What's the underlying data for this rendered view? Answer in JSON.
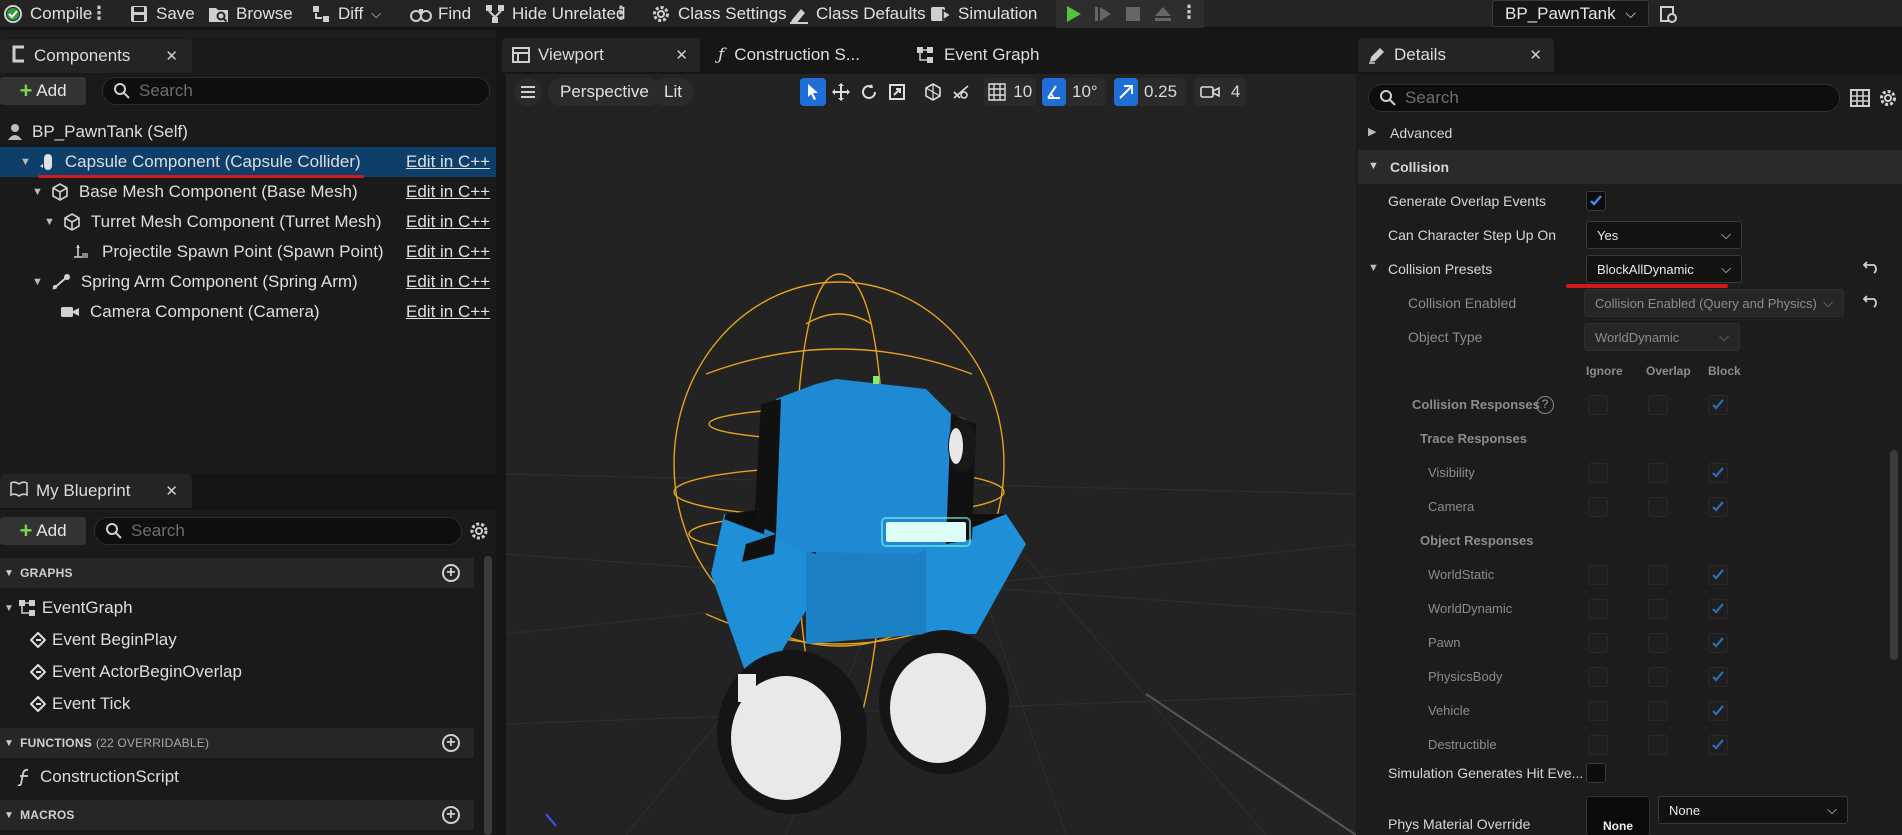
{
  "toolbar": {
    "compile": "Compile",
    "save": "Save",
    "browse": "Browse",
    "diff": "Diff",
    "find": "Find",
    "hide_unrelated": "Hide Unrelated",
    "class_settings": "Class Settings",
    "class_defaults": "Class Defaults",
    "simulation": "Simulation",
    "debug_object": "BP_PawnTank"
  },
  "components": {
    "tab_title": "Components",
    "add_label": "Add",
    "search_placeholder": "Search",
    "root": "BP_PawnTank (Self)",
    "items": [
      {
        "label": "Capsule Component (Capsule Collider)",
        "edit": "Edit in C++",
        "icon": "capsule-icon"
      },
      {
        "label": "Base Mesh Component (Base Mesh)",
        "edit": "Edit in C++",
        "icon": "static-mesh-icon"
      },
      {
        "label": "Turret Mesh Component (Turret Mesh)",
        "edit": "Edit in C++",
        "icon": "static-mesh-icon"
      },
      {
        "label": "Projectile Spawn Point (Spawn Point)",
        "edit": "Edit in C++",
        "icon": "scene-component-icon"
      },
      {
        "label": "Spring Arm Component (Spring Arm)",
        "edit": "Edit in C++",
        "icon": "spring-arm-icon"
      },
      {
        "label": "Camera Component (Camera)",
        "edit": "Edit in C++",
        "icon": "camera-icon"
      }
    ]
  },
  "my_blueprint": {
    "tab_title": "My Blueprint",
    "add_label": "Add",
    "search_placeholder": "Search",
    "graphs_header": "GRAPHS",
    "graph_name": "EventGraph",
    "events": [
      "Event BeginPlay",
      "Event ActorBeginOverlap",
      "Event Tick"
    ],
    "functions_header": "FUNCTIONS",
    "functions_sub": "(22 OVERRIDABLE)",
    "function_item": "ConstructionScript",
    "macros_header": "MACROS"
  },
  "editor_tabs": {
    "viewport": "Viewport",
    "construction": "Construction S...",
    "event_graph": "Event Graph"
  },
  "viewport": {
    "perspective": "Perspective",
    "lit": "Lit",
    "grid_snap": "10",
    "rotation_snap": "10°",
    "scale_snap": "0.25",
    "camera_speed": "4"
  },
  "details": {
    "tab_title": "Details",
    "search_placeholder": "Search",
    "advanced": "Advanced",
    "collision": "Collision",
    "generate_overlap": "Generate Overlap Events",
    "step_up": "Can Character Step Up On",
    "step_up_value": "Yes",
    "presets": "Collision Presets",
    "presets_value": "BlockAllDynamic",
    "collision_enabled": "Collision Enabled",
    "collision_enabled_value": "Collision Enabled (Query and Physics)",
    "object_type": "Object Type",
    "object_type_value": "WorldDynamic",
    "col_ignore": "Ignore",
    "col_overlap": "Overlap",
    "col_block": "Block",
    "collision_responses": "Collision Responses",
    "trace_responses": "Trace Responses",
    "trace_items": [
      "Visibility",
      "Camera"
    ],
    "object_responses": "Object Responses",
    "object_items": [
      "WorldStatic",
      "WorldDynamic",
      "Pawn",
      "PhysicsBody",
      "Vehicle",
      "Destructible"
    ],
    "sim_hit": "Simulation Generates Hit Eve...",
    "phys_material": "Phys Material Override",
    "phys_material_value": "None",
    "phys_thumb": "None"
  },
  "colors": {
    "accent_blue": "#1f6fd6",
    "selection": "#0e3f6b",
    "annotation_red": "#d11a1a",
    "play_green": "#57c23a",
    "tank_blue": "#1f8fd8",
    "capsule_orange": "#e6a21c"
  }
}
